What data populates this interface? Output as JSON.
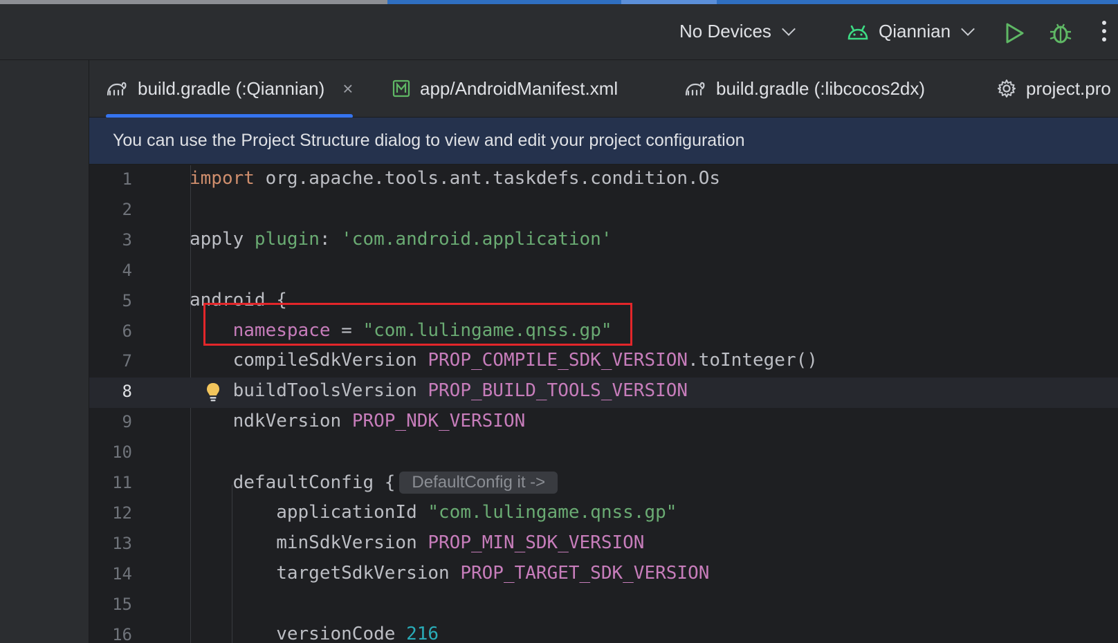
{
  "toolbar": {
    "devices_label": "No Devices",
    "config_label": "Qiannian"
  },
  "tabs": [
    {
      "label": "build.gradle (:Qiannian)",
      "icon": "gradle-elephant-icon",
      "active": true
    },
    {
      "label": "app/AndroidManifest.xml",
      "icon": "manifest-m-icon"
    },
    {
      "label": "build.gradle (:libcocos2dx)",
      "icon": "gradle-elephant-icon"
    },
    {
      "label": "project.pro",
      "icon": "gear-icon"
    }
  ],
  "tab_close": "×",
  "banner": {
    "text": "You can use the Project Structure dialog to view and edit your project configuration"
  },
  "editor": {
    "current_line": 8,
    "lines": [
      {
        "n": "1",
        "parts": [
          {
            "t": "import",
            "c": "kw"
          },
          {
            "t": " org.apache.tools.ant.taskdefs.condition.Os",
            "c": ""
          }
        ]
      },
      {
        "n": "2",
        "parts": []
      },
      {
        "n": "3",
        "parts": [
          {
            "t": "apply ",
            "c": ""
          },
          {
            "t": "plugin",
            "c": "str"
          },
          {
            "t": ": ",
            "c": ""
          },
          {
            "t": "'com.android.application'",
            "c": "str"
          }
        ]
      },
      {
        "n": "4",
        "parts": []
      },
      {
        "n": "5",
        "parts": [
          {
            "t": "android {",
            "c": ""
          }
        ]
      },
      {
        "n": "6",
        "parts": [
          {
            "t": "    ",
            "c": ""
          },
          {
            "t": "namespace",
            "c": "prop"
          },
          {
            "t": " = ",
            "c": ""
          },
          {
            "t": "\"com.lulingame.qnss.gp\"",
            "c": "str"
          }
        ]
      },
      {
        "n": "7",
        "parts": [
          {
            "t": "    compileSdkVersion ",
            "c": ""
          },
          {
            "t": "PROP_COMPILE_SDK_VERSION",
            "c": "prop"
          },
          {
            "t": ".toInteger()",
            "c": ""
          }
        ]
      },
      {
        "n": "8",
        "parts": [
          {
            "t": "    buildToolsVersion ",
            "c": ""
          },
          {
            "t": "PROP_BUILD_TOOLS_VERSION",
            "c": "prop"
          }
        ]
      },
      {
        "n": "9",
        "parts": [
          {
            "t": "    ndkVersion ",
            "c": ""
          },
          {
            "t": "PROP_NDK_VERSION",
            "c": "prop"
          }
        ]
      },
      {
        "n": "10",
        "parts": []
      },
      {
        "n": "11",
        "parts": [
          {
            "t": "    defaultConfig {",
            "c": ""
          }
        ],
        "hint": "DefaultConfig it ->"
      },
      {
        "n": "12",
        "parts": [
          {
            "t": "        applicationId ",
            "c": ""
          },
          {
            "t": "\"com.lulingame.qnss.gp\"",
            "c": "str"
          }
        ]
      },
      {
        "n": "13",
        "parts": [
          {
            "t": "        minSdkVersion ",
            "c": ""
          },
          {
            "t": "PROP_MIN_SDK_VERSION",
            "c": "prop"
          }
        ]
      },
      {
        "n": "14",
        "parts": [
          {
            "t": "        targetSdkVersion ",
            "c": ""
          },
          {
            "t": "PROP_TARGET_SDK_VERSION",
            "c": "prop"
          }
        ]
      },
      {
        "n": "15",
        "parts": []
      },
      {
        "n": "16",
        "parts": [
          {
            "t": "        versionCode ",
            "c": ""
          },
          {
            "t": "216",
            "c": "num"
          }
        ]
      }
    ]
  },
  "colors": {
    "keyword": "#cf8e6d",
    "string": "#6aab73",
    "property": "#c77dbb",
    "number": "#2aacb8",
    "highlight_box": "#e3262a",
    "accent": "#3574f0"
  }
}
